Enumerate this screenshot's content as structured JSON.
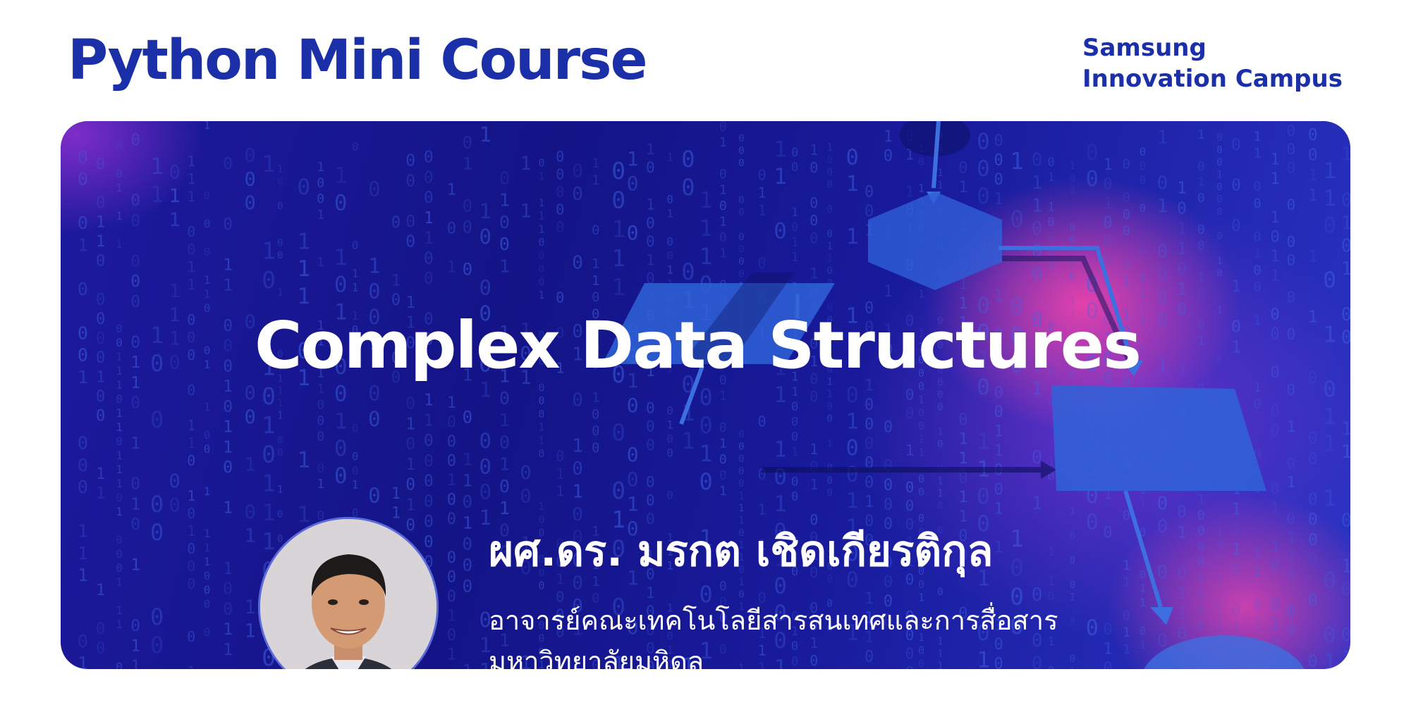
{
  "header": {
    "course_title": "Python Mini Course",
    "brand_line1": "Samsung",
    "brand_line2": "Innovation Campus"
  },
  "banner": {
    "headline": "Complex Data Structures",
    "speaker_name": "ผศ.ดร. มรกต เชิดเกียรติกุล",
    "speaker_title_line1": "อาจารย์คณะเทคโนโลยีสารสนเทศและการสื่อสาร",
    "speaker_title_line2": "มหาวิทยาลัยมหิดล"
  },
  "colors": {
    "brand_blue": "#1b2fa8",
    "banner_dark": "#141487",
    "accent_pink": "#ff46aa"
  }
}
